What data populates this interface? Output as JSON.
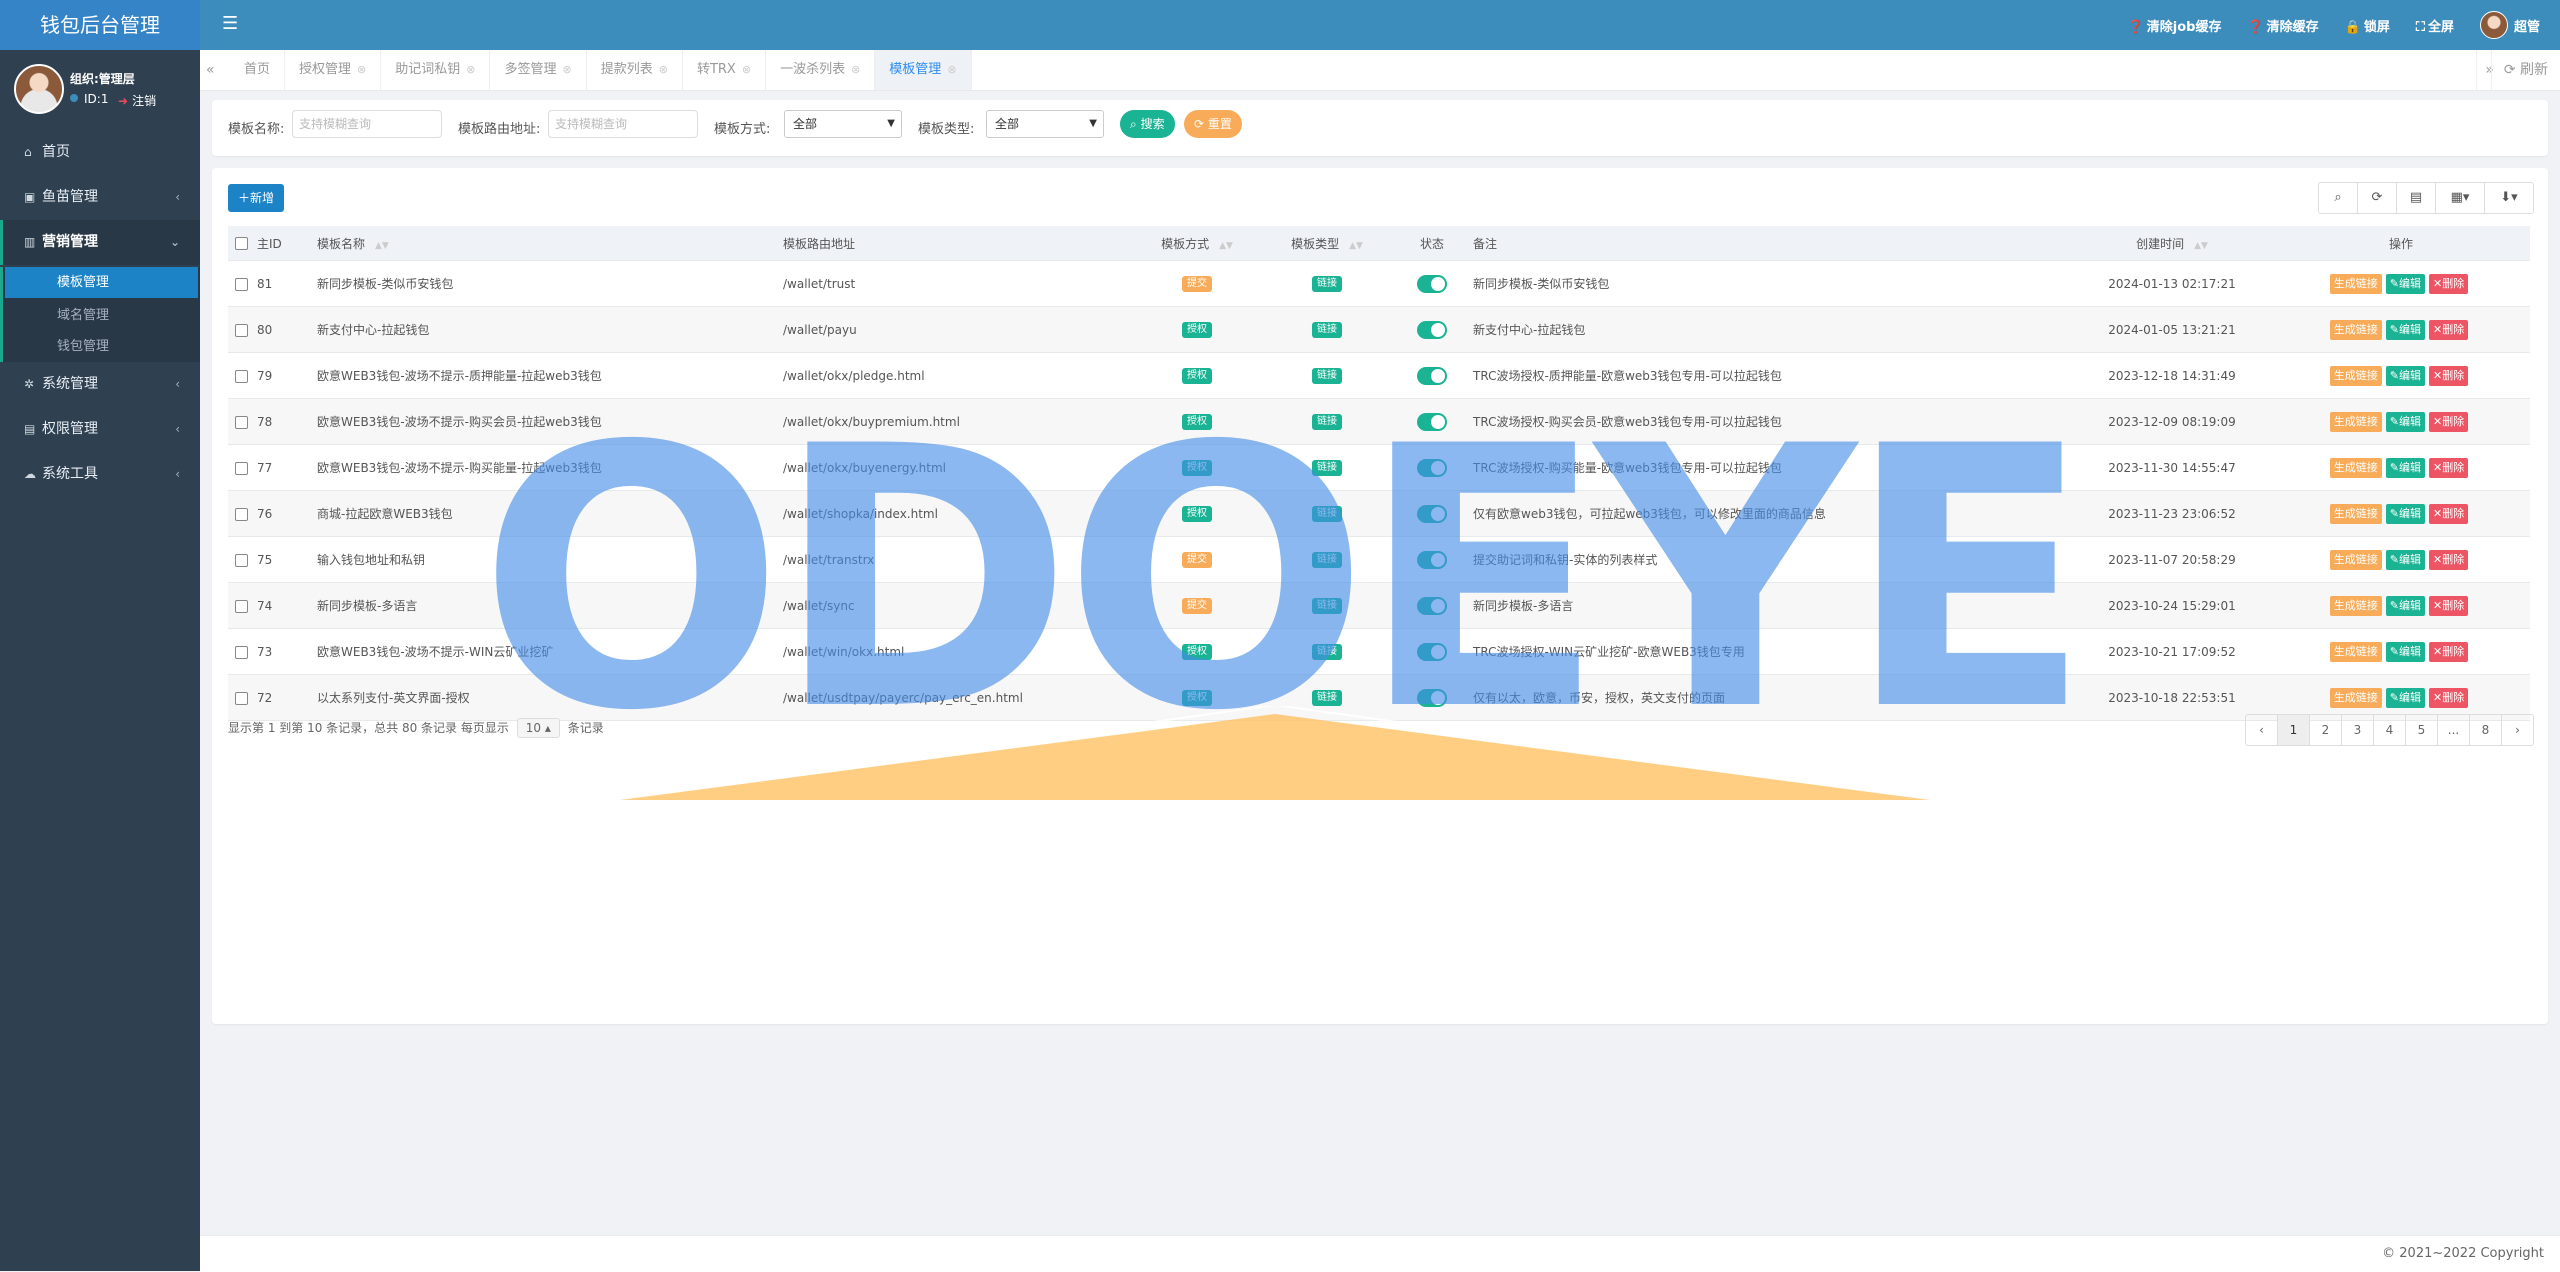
{
  "app": {
    "title": "钱包后台管理"
  },
  "profile": {
    "name": "组织:管理层",
    "id": "ID:1",
    "logout": "注销"
  },
  "sidebar": {
    "items": [
      {
        "icon": "⌂",
        "label": "首页"
      },
      {
        "icon": "▣",
        "label": "鱼苗管理"
      },
      {
        "icon": "▥",
        "label": "营销管理"
      },
      {
        "icon": "✲",
        "label": "系统管理"
      },
      {
        "icon": "▤",
        "label": "权限管理"
      },
      {
        "icon": "☁",
        "label": "系统工具"
      }
    ],
    "subitems": [
      "模板管理",
      "域名管理",
      "钱包管理"
    ]
  },
  "topbar": {
    "clear_job": "清除job缓存",
    "clear_cache": "清除缓存",
    "lock": "锁屏",
    "fullscreen": "全屏",
    "user": "超管"
  },
  "tabs": [
    "首页",
    "授权管理",
    "助记词私钥",
    "多签管理",
    "提款列表",
    "转TRX",
    "一波杀列表",
    "模板管理"
  ],
  "tabs_refresh": "刷新",
  "search": {
    "name_label": "模板名称:",
    "name_placeholder": "支持模糊查询",
    "path_label": "模板路由地址:",
    "path_placeholder": "支持模糊查询",
    "mode_label": "模板方式:",
    "mode_value": "全部",
    "type_label": "模板类型:",
    "type_value": "全部",
    "search_btn": "搜索",
    "reset_btn": "重置"
  },
  "toolbar": {
    "add": "新增"
  },
  "table": {
    "headers": {
      "id": "主ID",
      "name": "模板名称",
      "path": "模板路由地址",
      "mode": "模板方式",
      "type": "模板类型",
      "status": "状态",
      "remark": "备注",
      "created": "创建时间",
      "ops": "操作"
    },
    "op_labels": {
      "link": "生成链接",
      "edit": "编辑",
      "del": "删除"
    },
    "rows": [
      {
        "id": "81",
        "name": "新同步模板-类似币安钱包",
        "path": "/wallet/trust",
        "mode": "提交",
        "type": "链接",
        "remark": "新同步模板-类似币安钱包",
        "created": "2024-01-13 02:17:21"
      },
      {
        "id": "80",
        "name": "新支付中心-拉起钱包",
        "path": "/wallet/payu",
        "mode": "授权",
        "type": "链接",
        "remark": "新支付中心-拉起钱包",
        "created": "2024-01-05 13:21:21"
      },
      {
        "id": "79",
        "name": "欧意WEB3钱包-波场不提示-质押能量-拉起web3钱包",
        "path": "/wallet/okx/pledge.html",
        "mode": "授权",
        "type": "链接",
        "remark": "TRC波场授权-质押能量-欧意web3钱包专用-可以拉起钱包",
        "created": "2023-12-18 14:31:49"
      },
      {
        "id": "78",
        "name": "欧意WEB3钱包-波场不提示-购买会员-拉起web3钱包",
        "path": "/wallet/okx/buypremium.html",
        "mode": "授权",
        "type": "链接",
        "remark": "TRC波场授权-购买会员-欧意web3钱包专用-可以拉起钱包",
        "created": "2023-12-09 08:19:09"
      },
      {
        "id": "77",
        "name": "欧意WEB3钱包-波场不提示-购买能量-拉起web3钱包",
        "path": "/wallet/okx/buyenergy.html",
        "mode": "授权",
        "type": "链接",
        "remark": "TRC波场授权-购买能量-欧意web3钱包专用-可以拉起钱包",
        "created": "2023-11-30 14:55:47"
      },
      {
        "id": "76",
        "name": "商城-拉起欧意WEB3钱包",
        "path": "/wallet/shopka/index.html",
        "mode": "授权",
        "type": "链接",
        "remark": "仅有欧意web3钱包，可拉起web3钱包，可以修改里面的商品信息",
        "created": "2023-11-23 23:06:52"
      },
      {
        "id": "75",
        "name": "输入钱包地址和私钥",
        "path": "/wallet/transtrx",
        "mode": "提交",
        "type": "链接",
        "remark": "提交助记词和私钥-实体的列表样式",
        "created": "2023-11-07 20:58:29"
      },
      {
        "id": "74",
        "name": "新同步模板-多语言",
        "path": "/wallet/sync",
        "mode": "提交",
        "type": "链接",
        "remark": "新同步模板-多语言",
        "created": "2023-10-24 15:29:01"
      },
      {
        "id": "73",
        "name": "欧意WEB3钱包-波场不提示-WIN云矿业挖矿",
        "path": "/wallet/win/okx.html",
        "mode": "授权",
        "type": "链接",
        "remark": "TRC波场授权-WIN云矿业挖矿-欧意WEB3钱包专用",
        "created": "2023-10-21 17:09:52"
      },
      {
        "id": "72",
        "name": "以太系列支付-英文界面-授权",
        "path": "/wallet/usdtpay/payerc/pay_erc_en.html",
        "mode": "授权",
        "type": "链接",
        "remark": "仅有以太，欧意，币安，授权，英文支付的页面",
        "created": "2023-10-18 22:53:51"
      }
    ]
  },
  "pagination": {
    "info_prefix": "显示第 1 到第 10 条记录，总共 80 条记录",
    "per_page_label": "每页显示",
    "per_page_value": "10",
    "per_page_suffix": "条记录",
    "pages": [
      "‹",
      "1",
      "2",
      "3",
      "4",
      "5",
      "...",
      "8",
      "›"
    ],
    "current": "1"
  },
  "footer": {
    "copyright": "© 2021~2022 Copyright"
  },
  "watermark": {
    "text": "ODOEYE"
  },
  "colors": {
    "sidebar": "#2f4050",
    "topbar": "#3c8dbc",
    "primary": "#1c84c6",
    "success": "#1ab394",
    "warning": "#f8ac59",
    "danger": "#ed5565"
  }
}
